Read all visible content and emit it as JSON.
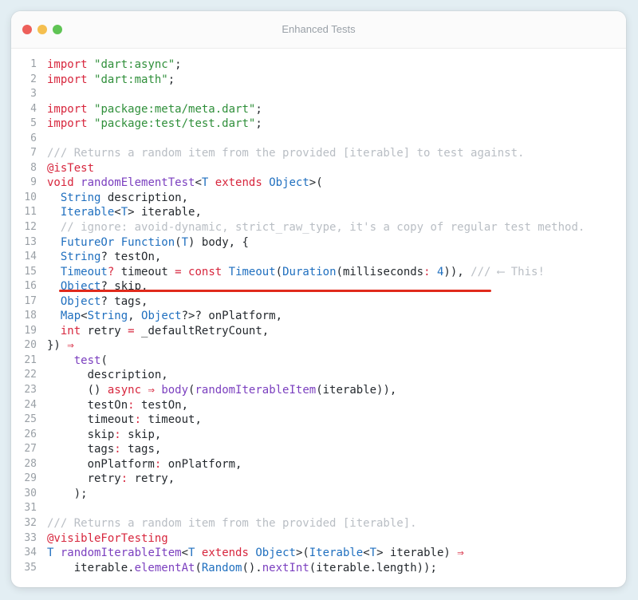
{
  "window": {
    "title": "Enhanced Tests",
    "controls": {
      "close_color": "#ed5f5a",
      "minimize_color": "#f5bf4f",
      "zoom_color": "#5fc454"
    }
  },
  "code": {
    "lines": [
      {
        "n": "1",
        "t": [
          {
            "c": "kw",
            "s": "import"
          },
          {
            "s": " "
          },
          {
            "c": "str",
            "s": "\"dart:async\""
          },
          {
            "s": ";"
          }
        ]
      },
      {
        "n": "2",
        "t": [
          {
            "c": "kw",
            "s": "import"
          },
          {
            "s": " "
          },
          {
            "c": "str",
            "s": "\"dart:math\""
          },
          {
            "s": ";"
          }
        ]
      },
      {
        "n": "3",
        "t": []
      },
      {
        "n": "4",
        "t": [
          {
            "c": "kw",
            "s": "import"
          },
          {
            "s": " "
          },
          {
            "c": "str",
            "s": "\"package:meta/meta.dart\""
          },
          {
            "s": ";"
          }
        ]
      },
      {
        "n": "5",
        "t": [
          {
            "c": "kw",
            "s": "import"
          },
          {
            "s": " "
          },
          {
            "c": "str",
            "s": "\"package:test/test.dart\""
          },
          {
            "s": ";"
          }
        ]
      },
      {
        "n": "6",
        "t": []
      },
      {
        "n": "7",
        "t": [
          {
            "c": "cm",
            "s": "/// Returns a random item from the provided [iterable] to test against."
          }
        ]
      },
      {
        "n": "8",
        "t": [
          {
            "c": "ann",
            "s": "@isTest"
          }
        ]
      },
      {
        "n": "9",
        "t": [
          {
            "c": "kw",
            "s": "void"
          },
          {
            "s": " "
          },
          {
            "c": "fn",
            "s": "randomElementTest"
          },
          {
            "s": "<"
          },
          {
            "c": "ty",
            "s": "T"
          },
          {
            "s": " "
          },
          {
            "c": "kw",
            "s": "extends"
          },
          {
            "s": " "
          },
          {
            "c": "ty",
            "s": "Object"
          },
          {
            "s": ">("
          }
        ]
      },
      {
        "n": "10",
        "t": [
          {
            "s": "  "
          },
          {
            "c": "ty",
            "s": "String"
          },
          {
            "s": " description,"
          }
        ]
      },
      {
        "n": "11",
        "t": [
          {
            "s": "  "
          },
          {
            "c": "ty",
            "s": "Iterable"
          },
          {
            "s": "<"
          },
          {
            "c": "ty",
            "s": "T"
          },
          {
            "s": "> iterable,"
          }
        ]
      },
      {
        "n": "12",
        "t": [
          {
            "s": "  "
          },
          {
            "c": "cm",
            "s": "// ignore: avoid-dynamic, strict_raw_type, it's a copy of regular test method."
          }
        ]
      },
      {
        "n": "13",
        "t": [
          {
            "s": "  "
          },
          {
            "c": "ty",
            "s": "FutureOr"
          },
          {
            "s": " "
          },
          {
            "c": "ty",
            "s": "Function"
          },
          {
            "s": "("
          },
          {
            "c": "ty",
            "s": "T"
          },
          {
            "s": ") body, {"
          }
        ]
      },
      {
        "n": "14",
        "t": [
          {
            "s": "  "
          },
          {
            "c": "ty",
            "s": "String"
          },
          {
            "s": "? testOn,"
          }
        ]
      },
      {
        "n": "15",
        "t": [
          {
            "s": "  "
          },
          {
            "c": "ty",
            "s": "Timeout"
          },
          {
            "c": "op",
            "s": "?"
          },
          {
            "s": " timeout "
          },
          {
            "c": "op",
            "s": "="
          },
          {
            "s": " "
          },
          {
            "c": "kw",
            "s": "const"
          },
          {
            "s": " "
          },
          {
            "c": "ty",
            "s": "Timeout"
          },
          {
            "s": "("
          },
          {
            "c": "ty",
            "s": "Duration"
          },
          {
            "s": "(milliseconds"
          },
          {
            "c": "op",
            "s": ":"
          },
          {
            "s": " "
          },
          {
            "c": "num",
            "s": "4"
          },
          {
            "s": ")),"
          },
          {
            "s": " "
          },
          {
            "c": "cm",
            "s": "/// ⟵ This!"
          }
        ]
      },
      {
        "n": "16",
        "t": [
          {
            "s": "  "
          },
          {
            "c": "ty",
            "s": "Object"
          },
          {
            "s": "? skip,"
          }
        ]
      },
      {
        "n": "17",
        "t": [
          {
            "s": "  "
          },
          {
            "c": "ty",
            "s": "Object"
          },
          {
            "s": "? tags,"
          }
        ]
      },
      {
        "n": "18",
        "t": [
          {
            "s": "  "
          },
          {
            "c": "ty",
            "s": "Map"
          },
          {
            "s": "<"
          },
          {
            "c": "ty",
            "s": "String"
          },
          {
            "s": ", "
          },
          {
            "c": "ty",
            "s": "Object"
          },
          {
            "s": "?>? onPlatform,"
          }
        ]
      },
      {
        "n": "19",
        "t": [
          {
            "s": "  "
          },
          {
            "c": "kw",
            "s": "int"
          },
          {
            "s": " retry "
          },
          {
            "c": "op",
            "s": "="
          },
          {
            "s": " _defaultRetryCount,"
          }
        ]
      },
      {
        "n": "20",
        "t": [
          {
            "s": "}) "
          },
          {
            "c": "op",
            "s": "⇒"
          }
        ]
      },
      {
        "n": "21",
        "t": [
          {
            "s": "    "
          },
          {
            "c": "fn",
            "s": "test"
          },
          {
            "s": "("
          }
        ]
      },
      {
        "n": "22",
        "t": [
          {
            "s": "      description,"
          }
        ]
      },
      {
        "n": "23",
        "t": [
          {
            "s": "      () "
          },
          {
            "c": "kw",
            "s": "async"
          },
          {
            "s": " "
          },
          {
            "c": "op",
            "s": "⇒"
          },
          {
            "s": " "
          },
          {
            "c": "fn",
            "s": "body"
          },
          {
            "s": "("
          },
          {
            "c": "fn",
            "s": "randomIterableItem"
          },
          {
            "s": "(iterable)),"
          }
        ]
      },
      {
        "n": "24",
        "t": [
          {
            "s": "      testOn"
          },
          {
            "c": "op",
            "s": ":"
          },
          {
            "s": " testOn,"
          }
        ]
      },
      {
        "n": "25",
        "t": [
          {
            "s": "      timeout"
          },
          {
            "c": "op",
            "s": ":"
          },
          {
            "s": " timeout,"
          }
        ]
      },
      {
        "n": "26",
        "t": [
          {
            "s": "      skip"
          },
          {
            "c": "op",
            "s": ":"
          },
          {
            "s": " skip,"
          }
        ]
      },
      {
        "n": "27",
        "t": [
          {
            "s": "      tags"
          },
          {
            "c": "op",
            "s": ":"
          },
          {
            "s": " tags,"
          }
        ]
      },
      {
        "n": "28",
        "t": [
          {
            "s": "      onPlatform"
          },
          {
            "c": "op",
            "s": ":"
          },
          {
            "s": " onPlatform,"
          }
        ]
      },
      {
        "n": "29",
        "t": [
          {
            "s": "      retry"
          },
          {
            "c": "op",
            "s": ":"
          },
          {
            "s": " retry,"
          }
        ]
      },
      {
        "n": "30",
        "t": [
          {
            "s": "    );"
          }
        ]
      },
      {
        "n": "31",
        "t": []
      },
      {
        "n": "32",
        "t": [
          {
            "c": "cm",
            "s": "/// Returns a random item from the provided [iterable]."
          }
        ]
      },
      {
        "n": "33",
        "t": [
          {
            "c": "ann",
            "s": "@visibleForTesting"
          }
        ]
      },
      {
        "n": "34",
        "t": [
          {
            "c": "ty",
            "s": "T"
          },
          {
            "s": " "
          },
          {
            "c": "fn",
            "s": "randomIterableItem"
          },
          {
            "s": "<"
          },
          {
            "c": "ty",
            "s": "T"
          },
          {
            "s": " "
          },
          {
            "c": "kw",
            "s": "extends"
          },
          {
            "s": " "
          },
          {
            "c": "ty",
            "s": "Object"
          },
          {
            "s": ">("
          },
          {
            "c": "ty",
            "s": "Iterable"
          },
          {
            "s": "<"
          },
          {
            "c": "ty",
            "s": "T"
          },
          {
            "s": "> iterable) "
          },
          {
            "c": "op",
            "s": "⇒"
          }
        ]
      },
      {
        "n": "35",
        "t": [
          {
            "s": "    iterable."
          },
          {
            "c": "fn",
            "s": "elementAt"
          },
          {
            "s": "("
          },
          {
            "c": "ty",
            "s": "Random"
          },
          {
            "s": "()."
          },
          {
            "c": "fn",
            "s": "nextInt"
          },
          {
            "s": "(iterable.length));"
          }
        ]
      }
    ]
  },
  "highlight": {
    "line": "15",
    "color": "#e02a1c"
  }
}
